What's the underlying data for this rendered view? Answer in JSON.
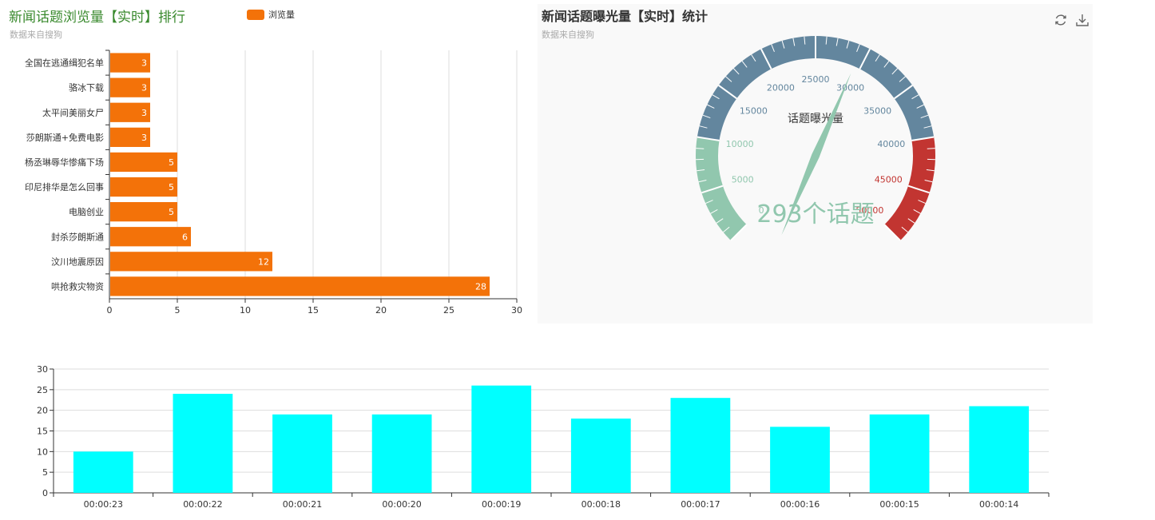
{
  "bar_chart": {
    "title": "新闻话题浏览量【实时】排行",
    "subtitle": "数据来自搜狗",
    "legend": "浏览量",
    "title_color": "#3a8a2e",
    "bar_color": "#f37209"
  },
  "gauge_chart": {
    "title": "新闻话题曝光量【实时】统计",
    "subtitle": "数据来自搜狗",
    "center_label": "话题曝光量",
    "value_label": "293个话题",
    "toolbox": [
      "refresh-icon",
      "download-icon"
    ],
    "colors": {
      "low": "#91c7ae",
      "mid": "#63869e",
      "high": "#c23531"
    }
  },
  "time_chart": {
    "bar_color": "#00ffff"
  },
  "chart_data": [
    {
      "type": "bar",
      "orientation": "horizontal",
      "categories": [
        "全国在逃通缉犯名单",
        "骆冰下载",
        "太平间美丽女尸",
        "莎朗斯通+免费电影",
        "杨丞琳辱华惨痛下场",
        "印尼排华是怎么回事",
        "电脑创业",
        "封杀莎朗斯通",
        "汶川地震原因",
        "哄抢救灾物资"
      ],
      "series": [
        {
          "name": "浏览量",
          "values": [
            3,
            3,
            3,
            3,
            5,
            5,
            5,
            6,
            12,
            28
          ]
        }
      ],
      "xlim": [
        0,
        30
      ],
      "xticks": [
        0,
        5,
        10,
        15,
        20,
        25,
        30
      ],
      "grid": true,
      "legend_position": "top"
    },
    {
      "type": "gauge",
      "min": 0,
      "max": 50000,
      "ticks": [
        0,
        5000,
        10000,
        15000,
        20000,
        25000,
        30000,
        35000,
        40000,
        45000,
        50000
      ],
      "tick_labels": [
        "0",
        "5000",
        "10000",
        "15000",
        "20000",
        "25000",
        "30000",
        "35000",
        "40000",
        "45000",
        "50000"
      ],
      "value": 29300,
      "bands": [
        {
          "to": 0.2,
          "color": "#91c7ae"
        },
        {
          "to": 0.8,
          "color": "#63869e"
        },
        {
          "to": 1.0,
          "color": "#c23531"
        }
      ]
    },
    {
      "type": "bar",
      "categories": [
        "00:00:23",
        "00:00:22",
        "00:00:21",
        "00:00:20",
        "00:00:19",
        "00:00:18",
        "00:00:17",
        "00:00:16",
        "00:00:15",
        "00:00:14"
      ],
      "values": [
        10,
        24,
        19,
        19,
        26,
        18,
        23,
        16,
        19,
        21
      ],
      "ylim": [
        0,
        30
      ],
      "yticks": [
        0,
        5,
        10,
        15,
        20,
        25,
        30
      ],
      "grid": true
    }
  ]
}
